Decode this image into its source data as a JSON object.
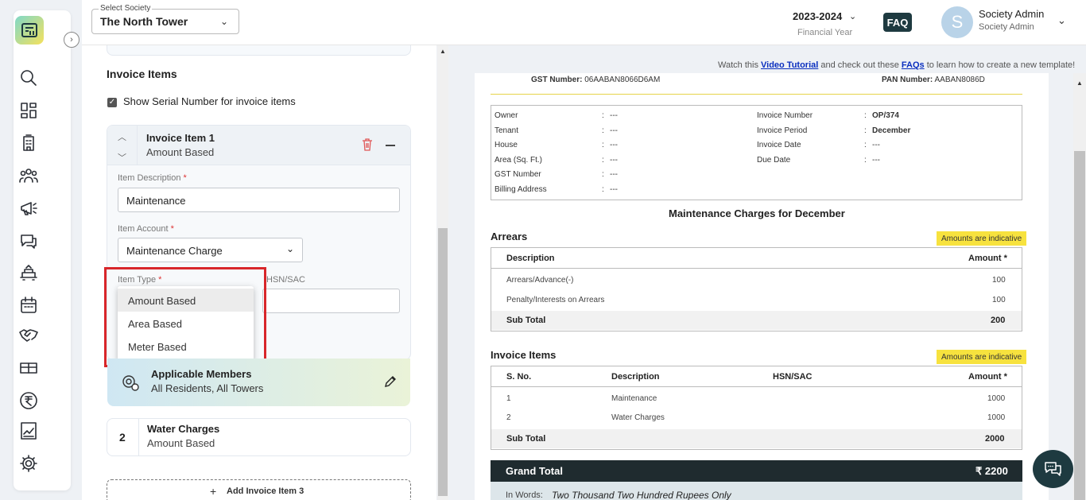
{
  "header": {
    "society_label": "Select Society",
    "society_value": "The North Tower",
    "fy_value": "2023-2024",
    "fy_label": "Financial Year",
    "faq": "FAQ",
    "avatar_initial": "S",
    "user_name": "Society Admin",
    "user_role": "Society Admin"
  },
  "sidebar": {
    "items": [
      "search-icon",
      "dashboard-icon",
      "building-icon",
      "members-icon",
      "announcement-icon",
      "chat-icon",
      "amenities-icon",
      "calendar-icon",
      "handshake-icon",
      "gift-icon",
      "rupee-icon",
      "reports-icon",
      "settings-icon"
    ]
  },
  "left": {
    "section_title": "Invoice Items",
    "serial_label": "Show Serial Number for invoice items",
    "item1": {
      "title": "Invoice Item 1",
      "type": "Amount Based",
      "desc_label": "Item Description",
      "desc_value": "Maintenance",
      "account_label": "Item Account",
      "account_value": "Maintenance Charge",
      "type_label": "Item Type",
      "hsn_label": "HSN/SAC",
      "type_options": [
        "Amount Based",
        "Area Based",
        "Meter Based"
      ],
      "members_title": "Applicable Members",
      "members_sub": "All Residents, All Towers"
    },
    "item2": {
      "num": "2",
      "title": "Water Charges",
      "type": "Amount Based"
    },
    "add_item": "Add Invoice Item 3"
  },
  "right": {
    "tutorial_pre": "Watch this ",
    "tutorial_link1": "Video Tutorial",
    "tutorial_mid": " and check out these ",
    "tutorial_link2": "FAQs",
    "tutorial_post": " to learn how to create a new template!",
    "gst_label": "GST Number:",
    "gst_value": " 06AABAN8066D6AM",
    "pan_label": "PAN Number:",
    "pan_value": " AABAN8086D",
    "info_left": [
      {
        "label": "Owner",
        "value": "---"
      },
      {
        "label": "Tenant",
        "value": "---"
      },
      {
        "label": "House",
        "value": "---"
      },
      {
        "label": "Area (Sq. Ft.)",
        "value": "---"
      },
      {
        "label": "GST Number",
        "value": "---"
      },
      {
        "label": "Billing Address",
        "value": "---"
      }
    ],
    "info_right": [
      {
        "label": "Invoice Number",
        "value": "OP/374"
      },
      {
        "label": "Invoice Period",
        "value": "December"
      },
      {
        "label": "Invoice Date",
        "value": "---"
      },
      {
        "label": "Due Date",
        "value": "---"
      }
    ],
    "colon": ":",
    "maint_title": "Maintenance Charges for December",
    "arrears_title": "Arrears",
    "badge": "Amounts are indicative",
    "arrears_head": {
      "desc": "Description",
      "amount": "Amount *"
    },
    "arrears_rows": [
      {
        "desc": "Arrears/Advance(-)",
        "amount": "100"
      },
      {
        "desc": "Penalty/Interests on Arrears",
        "amount": "100"
      }
    ],
    "arrears_subtotal": {
      "label": "Sub Total",
      "value": "200"
    },
    "items_title": "Invoice Items",
    "items_head": {
      "sno": "S. No.",
      "desc": "Description",
      "hsn": "HSN/SAC",
      "amount": "Amount *"
    },
    "items_rows": [
      {
        "sno": "1",
        "desc": "Maintenance",
        "amount": "1000"
      },
      {
        "sno": "2",
        "desc": "Water Charges",
        "amount": "1000"
      }
    ],
    "items_subtotal": {
      "label": "Sub Total",
      "value": "2000"
    },
    "grand_label": "Grand Total",
    "grand_value": "₹ 2200",
    "words_label": "In Words:",
    "words_value": "Two Thousand Two Hundred Rupees Only"
  },
  "colors": {
    "accent": "#1e3a40",
    "highlight": "#d8262a",
    "badge": "#f7e23e"
  }
}
